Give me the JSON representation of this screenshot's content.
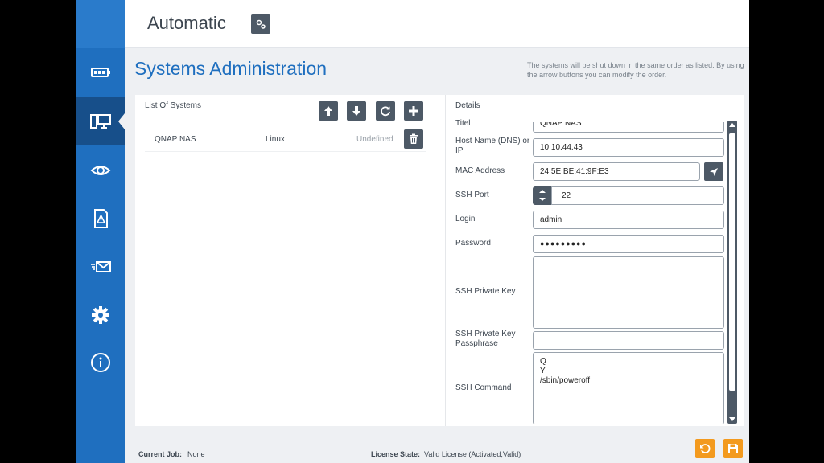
{
  "header": {
    "mode_title": "Automatic"
  },
  "page": {
    "title": "Systems Administration",
    "order_note": "The systems will be shut down in the same order as listed. By using the arrow buttons you can modify the order."
  },
  "list_panel": {
    "title": "List Of Systems",
    "systems": [
      {
        "name": "QNAP NAS",
        "os": "Linux",
        "status": "Undefined"
      }
    ]
  },
  "details": {
    "title": "Details",
    "fields": {
      "titel": {
        "label": "Titel",
        "value": "QNAP NAS"
      },
      "host": {
        "label": "Host Name (DNS) or IP",
        "value": "10.10.44.43"
      },
      "mac": {
        "label": "MAC Address",
        "value": "24:5E:BE:41:9F:E3"
      },
      "ssh_port": {
        "label": "SSH Port",
        "value": "22"
      },
      "login": {
        "label": "Login",
        "value": "admin"
      },
      "password": {
        "label": "Password",
        "value": "●●●●●●●●●"
      },
      "ssh_key": {
        "label": "SSH Private Key",
        "value": ""
      },
      "ssh_passphrase": {
        "label": "SSH Private Key Passphrase",
        "value": ""
      },
      "ssh_command": {
        "label": "SSH Command",
        "value": "Q\nY\n/sbin/poweroff"
      }
    }
  },
  "footer": {
    "current_job_label": "Current Job:",
    "current_job_value": "None",
    "license_label": "License State:",
    "license_value": "Valid License (Activated,Valid)"
  },
  "colors": {
    "sidebar": "#1f6fbf",
    "accent": "#f39a1e",
    "button": "#4d5966"
  }
}
